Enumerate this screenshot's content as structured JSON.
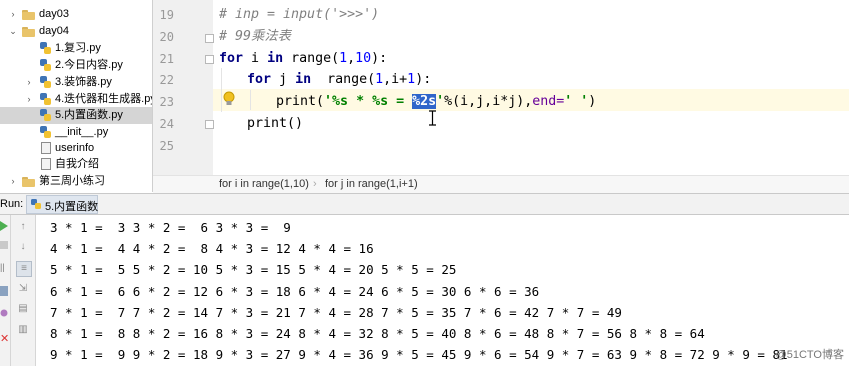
{
  "project_tree": {
    "items": [
      {
        "label": "day03",
        "kind": "folder",
        "arrow": "›"
      },
      {
        "label": "day04",
        "kind": "folder",
        "arrow": "⌄"
      },
      {
        "label": "1.复习.py",
        "kind": "py"
      },
      {
        "label": "2.今日内容.py",
        "kind": "py"
      },
      {
        "label": "3.装饰器.py",
        "kind": "py",
        "arrow": "›"
      },
      {
        "label": "4.迭代器和生成器.py",
        "kind": "py",
        "arrow": "›"
      },
      {
        "label": "5.内置函数.py",
        "kind": "py",
        "selected": true
      },
      {
        "label": "__init__.py",
        "kind": "py"
      },
      {
        "label": "userinfo",
        "kind": "txt"
      },
      {
        "label": "自我介绍",
        "kind": "txt"
      },
      {
        "label": "第三周小练习",
        "kind": "folder",
        "arrow": "›"
      }
    ]
  },
  "editor": {
    "line_numbers": [
      "19",
      "20",
      "21",
      "22",
      "23",
      "24",
      "25"
    ],
    "lines": {
      "l19": "# inp = input('>>>')",
      "l20": "# 99乘法表",
      "l21_kw1": "for",
      "l21_mid": " i ",
      "l21_kw2": "in",
      "l21_a": " range(",
      "l21_n1": "1",
      "l21_b": ",",
      "l21_n2": "10",
      "l21_c": "):",
      "l22_kw1": "for",
      "l22_mid": " j ",
      "l22_kw2": "in",
      "l22_a": "  range(",
      "l22_n1": "1",
      "l22_b": ",i+",
      "l22_n2": "1",
      "l22_c": "):",
      "l23_a": "print(",
      "l23_str1": "'%s * %s = ",
      "l23_sel": "%2s",
      "l23_str2": "'",
      "l23_b": "%(i,j,i*j),",
      "l23_kw": "end=",
      "l23_str3": "' '",
      "l23_c": ")",
      "l24": "print()"
    },
    "breadcrumb": [
      "for i in range(1,10)",
      "for j in range(1,i+1)"
    ]
  },
  "run": {
    "label": "Run:",
    "tab": "5.内置函数",
    "output": [
      "3 * 1 =  3 3 * 2 =  6 3 * 3 =  9",
      "4 * 1 =  4 4 * 2 =  8 4 * 3 = 12 4 * 4 = 16",
      "5 * 1 =  5 5 * 2 = 10 5 * 3 = 15 5 * 4 = 20 5 * 5 = 25",
      "6 * 1 =  6 6 * 2 = 12 6 * 3 = 18 6 * 4 = 24 6 * 5 = 30 6 * 6 = 36",
      "7 * 1 =  7 7 * 2 = 14 7 * 3 = 21 7 * 4 = 28 7 * 5 = 35 7 * 6 = 42 7 * 7 = 49",
      "8 * 1 =  8 8 * 2 = 16 8 * 3 = 24 8 * 4 = 32 8 * 5 = 40 8 * 6 = 48 8 * 7 = 56 8 * 8 = 64",
      "9 * 1 =  9 9 * 2 = 18 9 * 3 = 27 9 * 4 = 36 9 * 5 = 45 9 * 6 = 54 9 * 7 = 63 9 * 8 = 72 9 * 9 = 81"
    ]
  },
  "watermark": "@51CTO博客",
  "colors": {
    "keyword": "#000080",
    "string": "#008000",
    "number": "#0000ff",
    "comment": "#808080",
    "selection": "#2f65ca",
    "current_line": "#fffae3"
  }
}
